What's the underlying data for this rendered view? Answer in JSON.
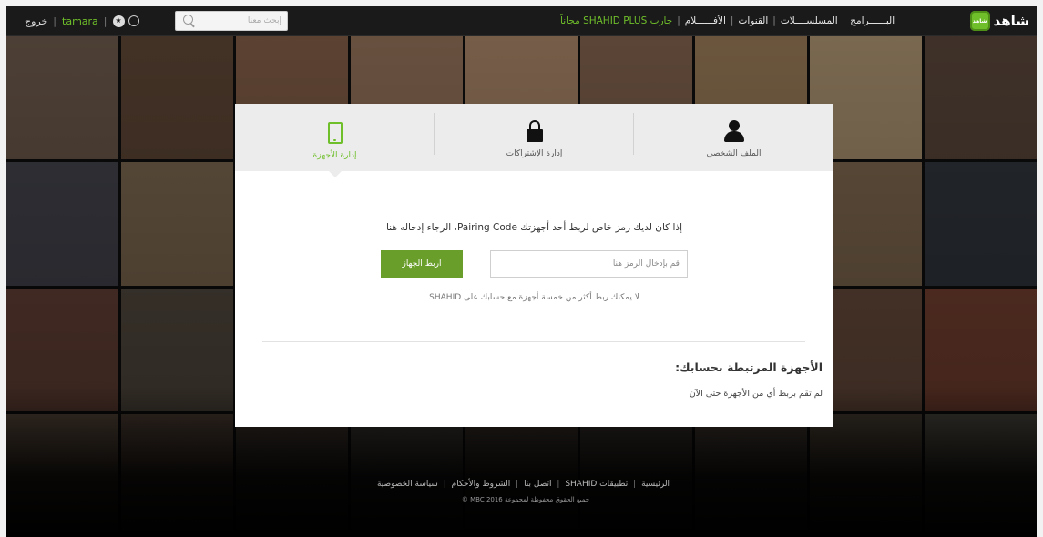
{
  "topbar": {
    "logout_label": "خروج",
    "username": "tamara",
    "search_placeholder": "إبحث معنا",
    "logo_text": "شاهد",
    "logo_badge": "شاهد",
    "nav": [
      {
        "label": "البــــــرامج"
      },
      {
        "label": "المسلســــلات"
      },
      {
        "label": "القنوات"
      },
      {
        "label": "الأفــــــلام"
      },
      {
        "label": "جارب SHAHID PLUS مجاناً"
      }
    ]
  },
  "tabs": [
    {
      "label": "الملف الشخصي",
      "icon": "user-icon"
    },
    {
      "label": "إدارة الإشتراكات",
      "icon": "lock-icon"
    },
    {
      "label": "إدارة الأجهزة",
      "icon": "phone-icon",
      "active": true
    }
  ],
  "devices": {
    "instruction": "إذا كان لديك رمز خاص لربط أحد أجهزتك Pairing Code، الرجاء إدخاله هنا",
    "input_placeholder": "قم بإدخال الرمز هنا",
    "input_value": "",
    "pair_button": "اربط الجهاز",
    "limit_note": "لا يمكنك ربط أكثر من خمسة أجهزة مع حسابك على SHAHID",
    "linked_title": "الأجهزة المرتبطة بحسابك:",
    "linked_empty": "لم تقم بربط أي من الأجهزة حتى الآن"
  },
  "footer": {
    "links": [
      "الرئيسية",
      "تطبيقات SHAHID",
      "اتصل بنا",
      "الشروط والأحكام",
      "سياسة الخصوصية"
    ],
    "copyright": "جميع الحقوق محفوظة لمجموعة MBC 2016 ©"
  },
  "colors": {
    "accent": "#6fbf2a",
    "button": "#6a9e2a",
    "topbar": "#1a1a1a"
  }
}
